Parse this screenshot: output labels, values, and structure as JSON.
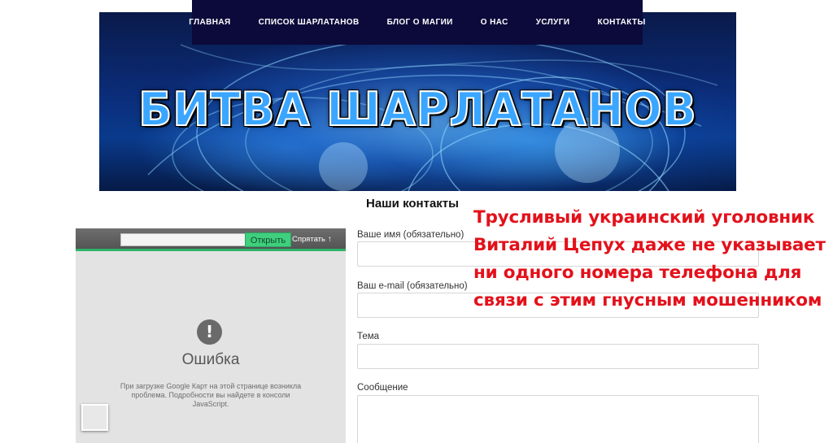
{
  "nav": {
    "items": [
      {
        "label": "ГЛАВНАЯ"
      },
      {
        "label": "СПИСОК ШАРЛАТАНОВ"
      },
      {
        "label": "БЛОГ О МАГИИ"
      },
      {
        "label": "О НАС"
      },
      {
        "label": "УСЛУГИ"
      },
      {
        "label": "КОНТАКТЫ"
      }
    ],
    "background": "#0c0a3a"
  },
  "banner": {
    "title": "БИТВА ШАРЛАТАНОВ",
    "title_color": "#3aa6ff"
  },
  "page": {
    "heading": "Наши контакты"
  },
  "annotation": {
    "lines": [
      "Трусливый украинский уголовник",
      "Виталий Цепух даже не указывает",
      "ни одного номера телефона для",
      "связи с этим гнусным мошенником"
    ],
    "color": "#e3111b"
  },
  "map": {
    "search_value": "",
    "open_button": "Открыть",
    "hide_label": "Спрятать",
    "hide_icon": "arrow-up-icon",
    "error_icon": "exclamation-icon",
    "error_title": "Ошибка",
    "error_text": "При загрузке Google Карт на этой странице возникла проблема. Подробности вы найдете в консоли JavaScript.",
    "accent": "#2fb36b"
  },
  "form": {
    "name_label": "Ваше имя (обязательно)",
    "name_value": "",
    "email_label": "Ваш e-mail (обязательно)",
    "email_value": "",
    "subject_label": "Тема",
    "subject_value": "",
    "message_label": "Сообщение",
    "message_value": ""
  }
}
